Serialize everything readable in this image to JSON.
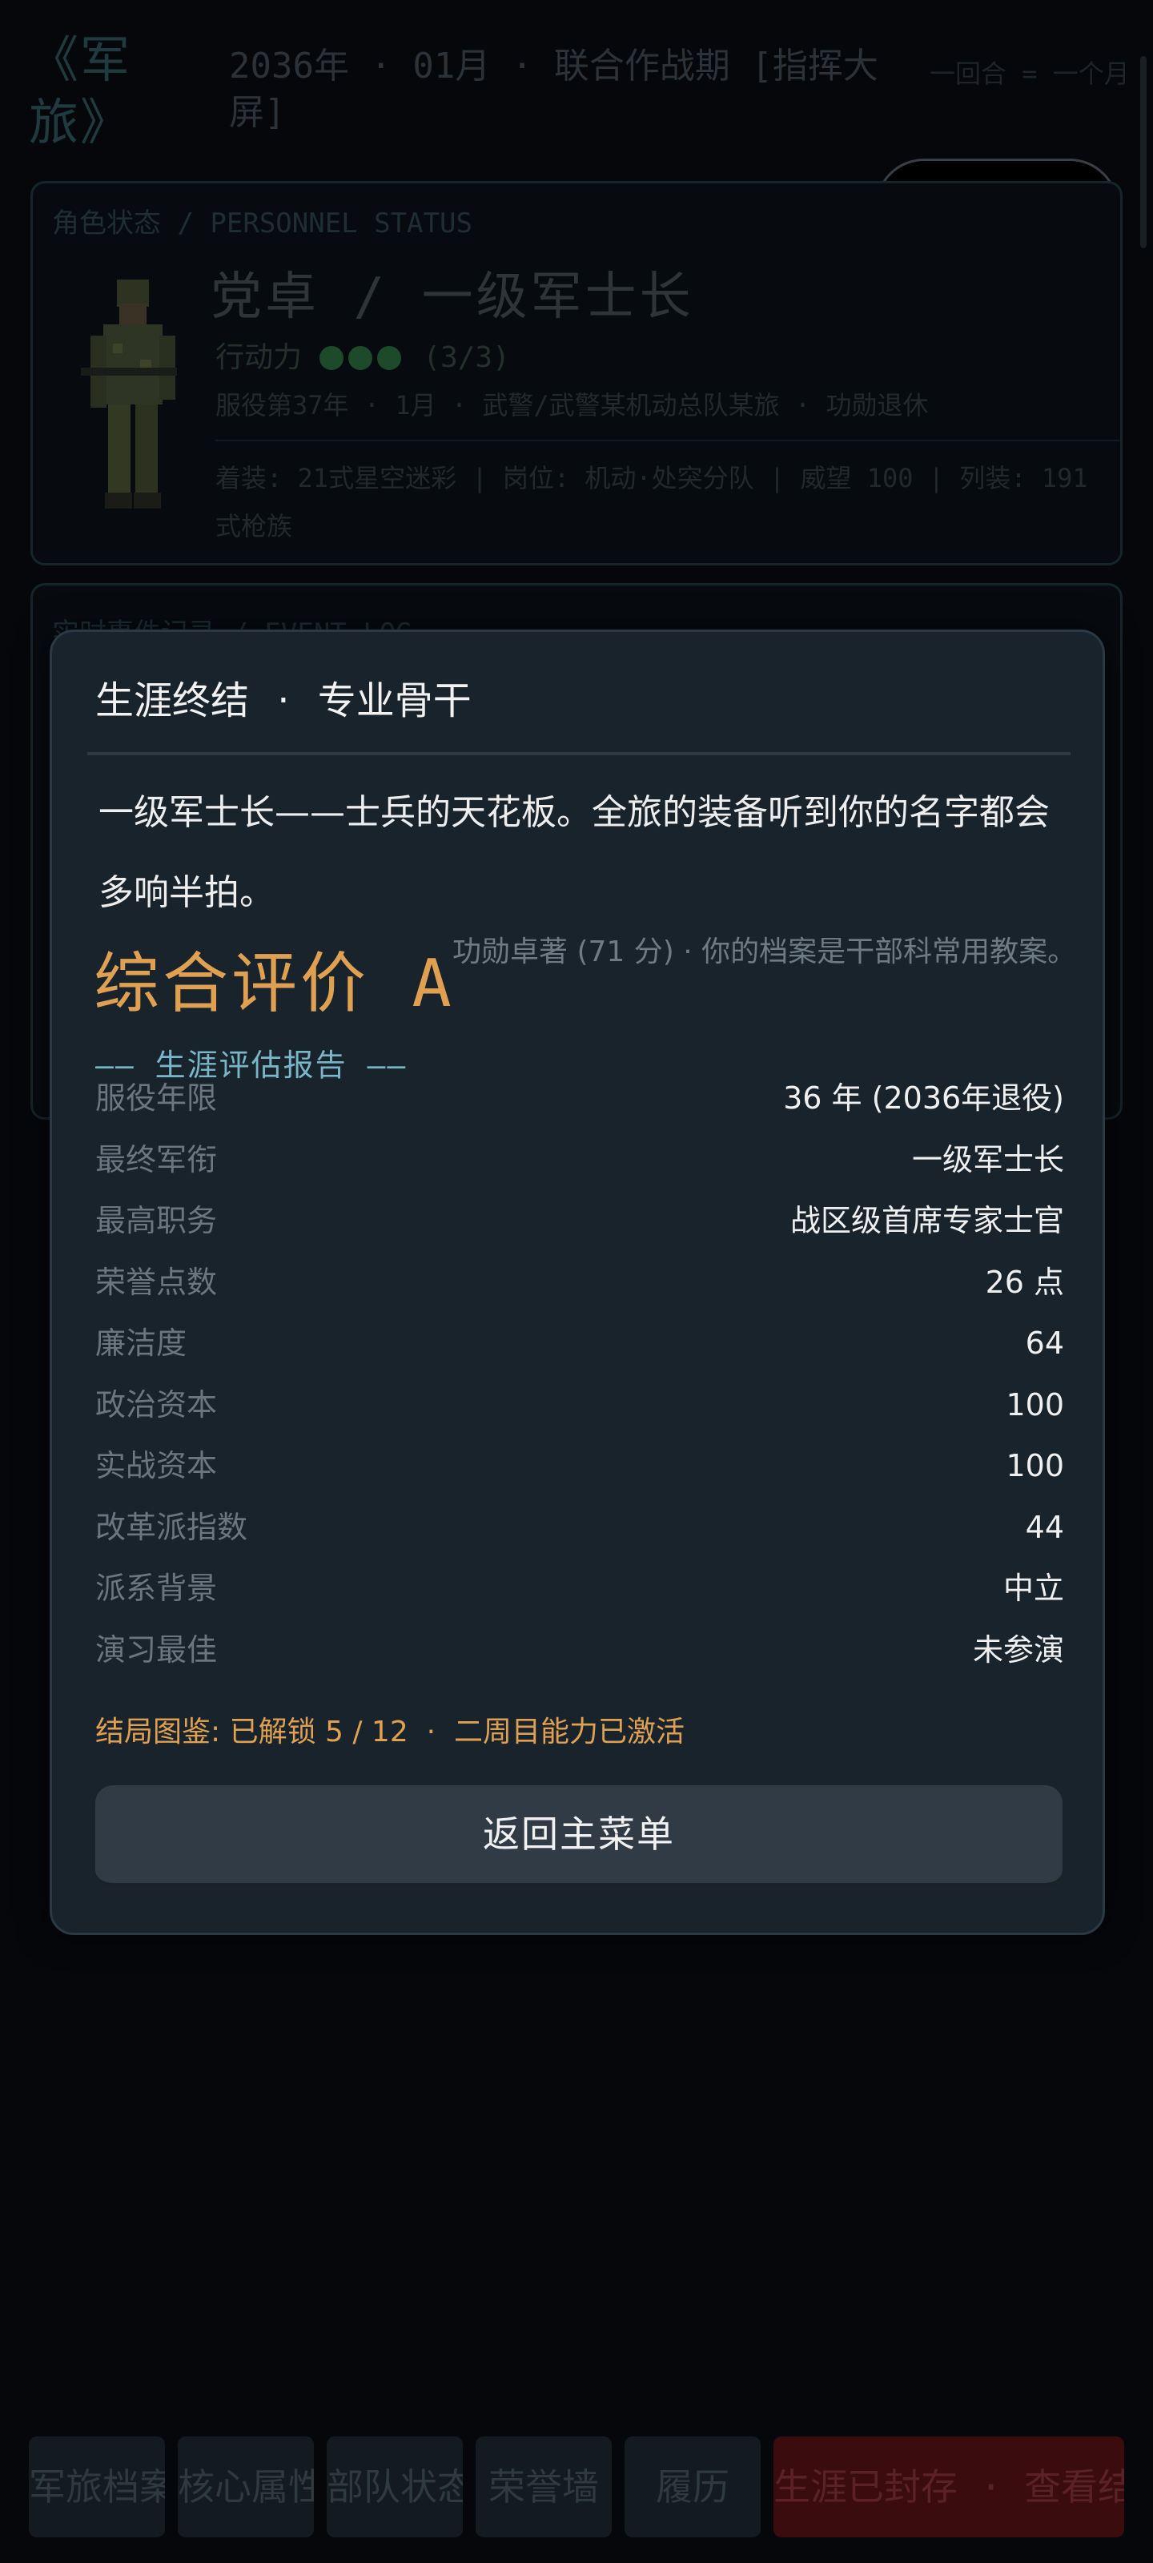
{
  "header": {
    "game_title": "《军旅》",
    "date_line": "2036年 · 01月 · 联合作战期 [指挥大屏]",
    "turn_note": "一回合 = 一个月"
  },
  "status_card": {
    "section_title": "角色状态 / PERSONNEL STATUS",
    "name_rank": "党卓  /  一级军士长",
    "ap_label": "行动力",
    "ap_value": "(3/3)",
    "ap_pips": 3,
    "service_line": "服役第37年 · 1月 · 武警/武警某机动总队某旅 · 功勋退休",
    "gear_line": "着装: 21式星空迷彩 | 岗位: 机动·处突分队 | 威望 100 | 列装: 191式枪族"
  },
  "event_card": {
    "section_title": "实时事件记录 / EVENT LOG"
  },
  "modal": {
    "title": "生涯终结 · 专业骨干",
    "description": "一级军士长——士兵的天花板。全旅的装备听到你的名字都会多响半拍。",
    "grade": "综合评价 A",
    "grade_note": "功勋卓著 (71 分) · 你的档案是干部科常用教案。",
    "report_title": "—— 生涯评估报告 ——",
    "stats": [
      {
        "label": "服役年限",
        "value": "36 年 (2036年退役)"
      },
      {
        "label": "最终军衔",
        "value": "一级军士长"
      },
      {
        "label": "最高职务",
        "value": "战区级首席专家士官"
      },
      {
        "label": "荣誉点数",
        "value": "26 点"
      },
      {
        "label": "廉洁度",
        "value": "64"
      },
      {
        "label": "政治资本",
        "value": "100"
      },
      {
        "label": "实战资本",
        "value": "100"
      },
      {
        "label": "改革派指数",
        "value": "44"
      },
      {
        "label": "派系背景",
        "value": "中立"
      },
      {
        "label": "演习最佳",
        "value": "未参演"
      }
    ],
    "ending_line": "结局图鉴: 已解锁 5 / 12  ·  二周目能力已激活",
    "menu_button": "返回主菜单"
  },
  "bottom_nav": {
    "items": [
      "军旅档案",
      "核心属性",
      "部队状态",
      "荣誉墙",
      "履历"
    ],
    "danger_item": "生涯已封存  ·  查看结局"
  },
  "colors": {
    "accent_gold": "#e0a052",
    "accent_cyan": "#79b7c8",
    "modal_bg": "#19232c",
    "danger_bg": "#3a0c0e"
  },
  "icons": [
    "more-dots-icon",
    "close-target-icon",
    "soldier-portrait-icon"
  ]
}
